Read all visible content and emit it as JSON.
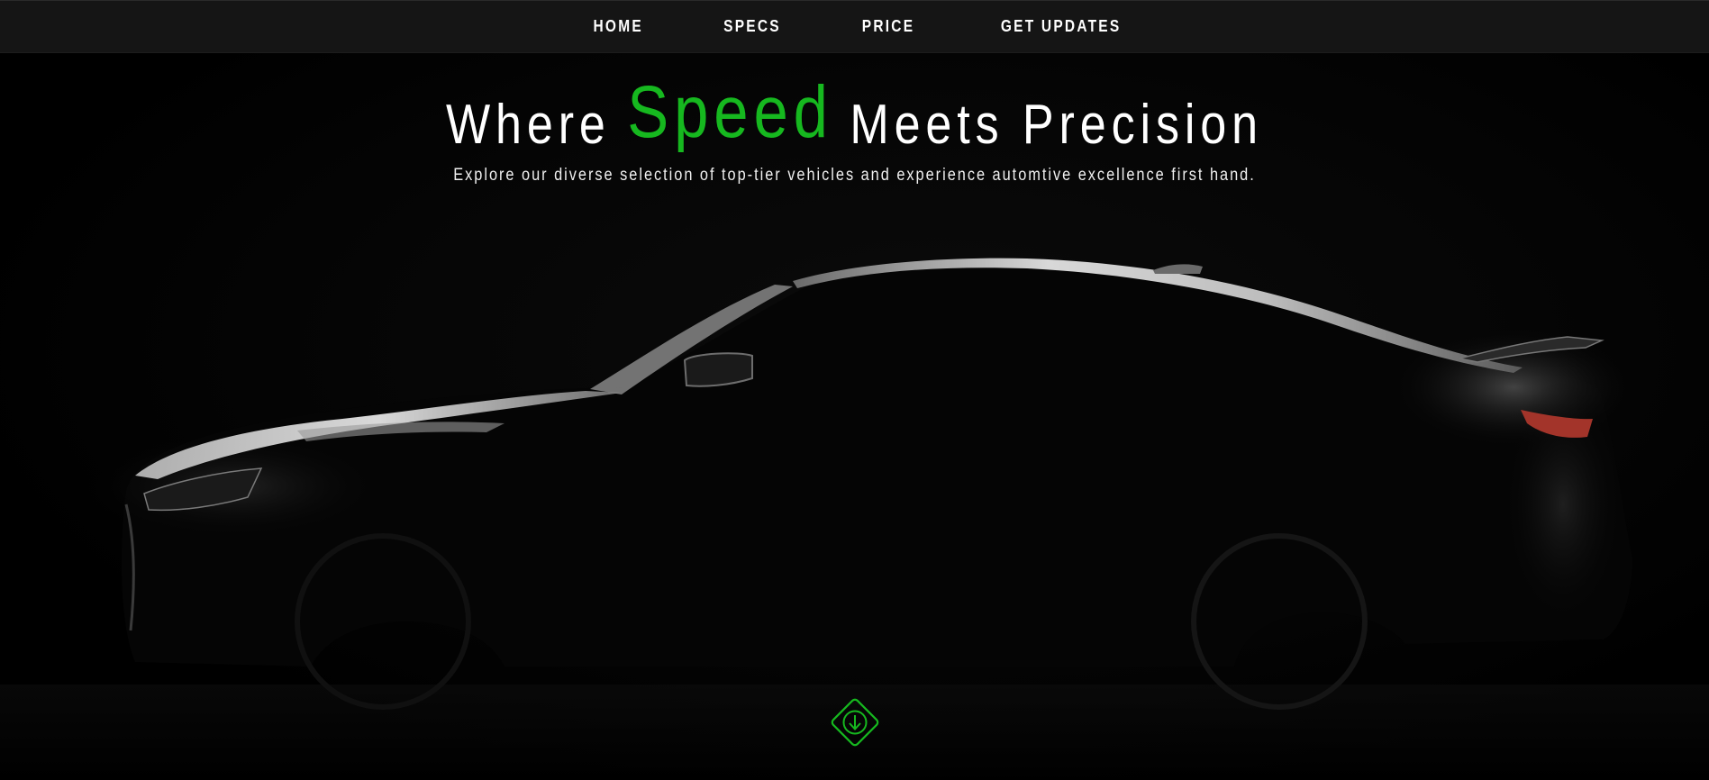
{
  "nav": {
    "items": [
      {
        "label": "HOME"
      },
      {
        "label": "SPECS"
      },
      {
        "label": "PRICE"
      },
      {
        "label": "GET UPDATES"
      }
    ]
  },
  "hero": {
    "title_before": "Where",
    "title_accent": "Speed",
    "title_after": "Meets Precision",
    "subtitle": "Explore our diverse selection of top-tier vehicles and experience automtive excellence first hand."
  },
  "scroll": {
    "icon": "arrow-down-icon"
  },
  "colors": {
    "accent": "#16b81f",
    "nav_bg": "#151515",
    "background": "#000000",
    "text": "#ffffff"
  }
}
